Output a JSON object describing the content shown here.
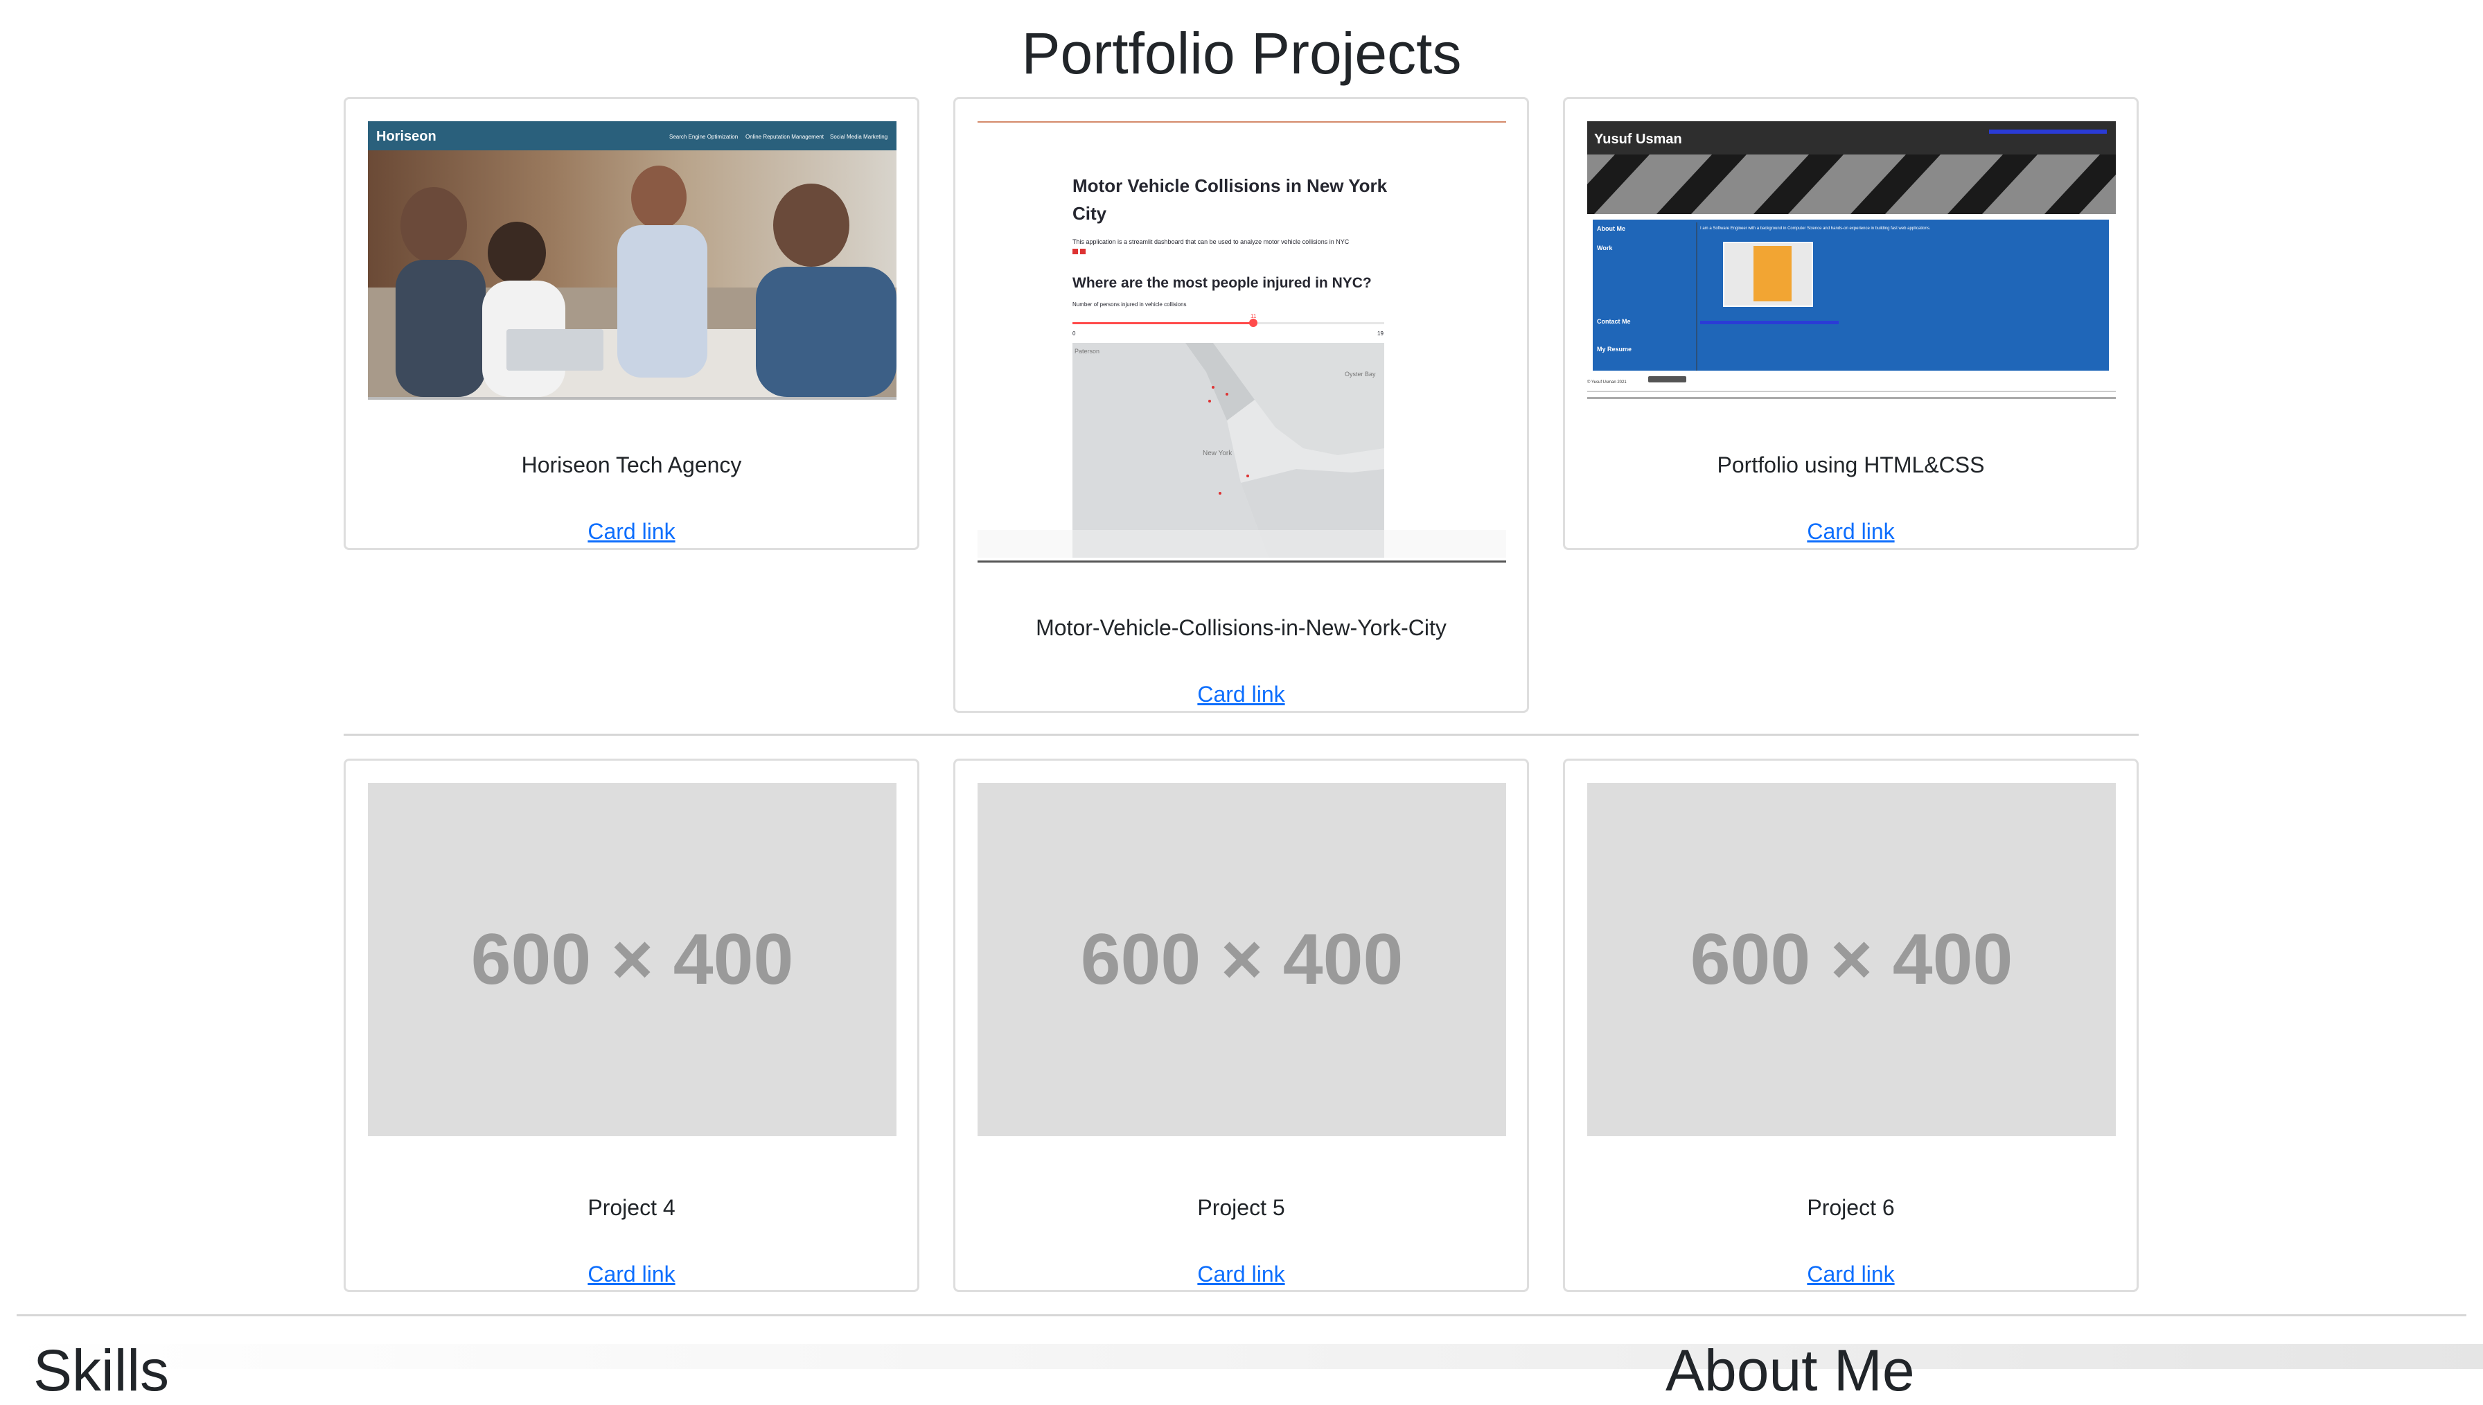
{
  "page": {
    "title": "Portfolio Projects"
  },
  "cards": [
    {
      "title": "Horiseon Tech Agency",
      "link": "Card link"
    },
    {
      "title": "Motor-Vehicle-Collisions-in-New-York-City",
      "link": "Card link"
    },
    {
      "title": "Portfolio using HTML&CSS",
      "link": "Card link"
    },
    {
      "title": "Project 4",
      "link": "Card link",
      "placeholder": "600 × 400"
    },
    {
      "title": "Project 5",
      "link": "Card link",
      "placeholder": "600 × 400"
    },
    {
      "title": "Project 6",
      "link": "Card link",
      "placeholder": "600 × 400"
    }
  ],
  "thumb_horiseon": {
    "brand": "Horiseon",
    "nav": [
      "Search Engine Optimization",
      "Online Reputation Management",
      "Social Media Marketing"
    ]
  },
  "thumb_mvc": {
    "heading": "Motor Vehicle Collisions in New York",
    "heading_line2": "City",
    "intro": "This application is a streamlit dashboard that can be used to analyze motor vehicle collisions in NYC",
    "question": "Where are the most people injured in NYC?",
    "slider_label": "Number of persons injured in vehicle collisions",
    "slider_min": "0",
    "slider_max": "19",
    "slider_value": "11",
    "slider_fraction": 0.58,
    "map_labels": [
      "Paterson",
      "Oyster Bay",
      "New York"
    ]
  },
  "thumb_portfolio": {
    "name": "Yusuf Usman",
    "nav": [
      "About Me",
      "Work",
      "Contact Me",
      "My Resume"
    ],
    "about": "I am a Software Engineer with a background in Computer Science and hands-on experience in building fast web applications.",
    "footer": "© Yusuf Usman 2021"
  },
  "sections": {
    "skills": "Skills",
    "about": "About Me"
  },
  "colors": {
    "link": "#0d6efd",
    "horiseon_header": "#2a607c",
    "portfolio_blue": "#1f66b8",
    "slider_red": "#ff4b4b",
    "placeholder_bg": "#dddddd",
    "placeholder_text": "#9a9a9a"
  }
}
